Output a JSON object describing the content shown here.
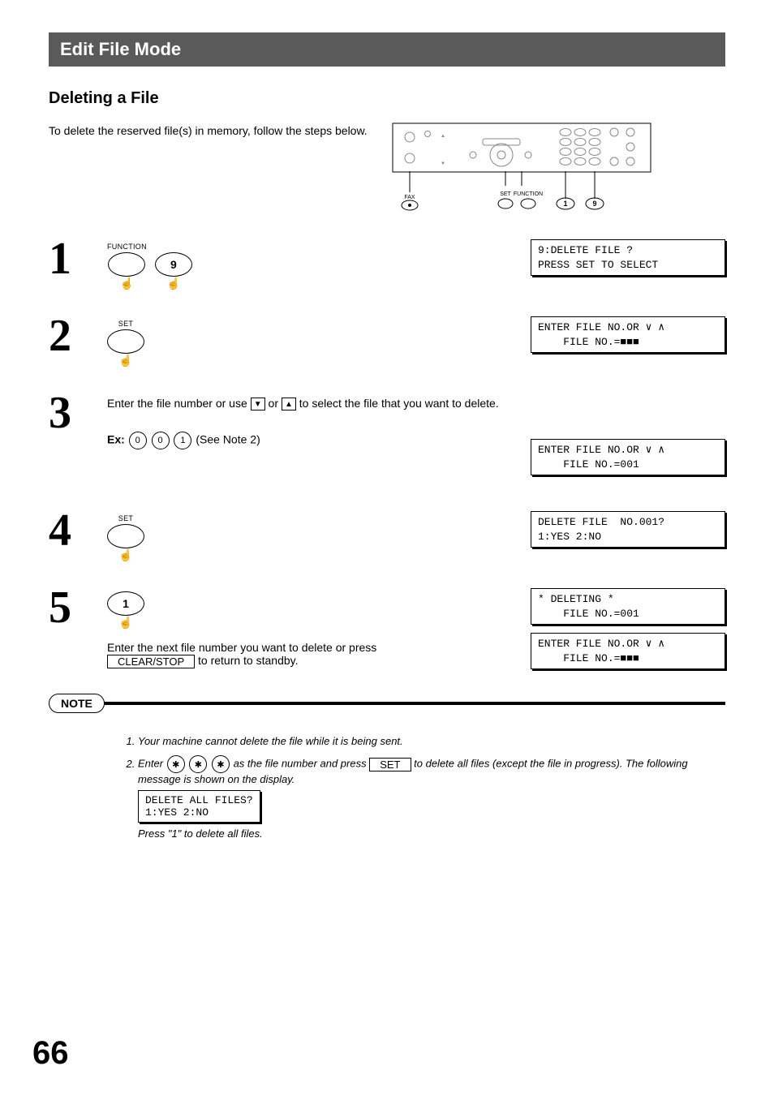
{
  "section_title": "Edit File Mode",
  "subheading": "Deleting a File",
  "intro": "To delete the reserved file(s) in memory, follow the steps below.",
  "panel_callouts": {
    "fax": "FAX",
    "set": "SET",
    "function": "FUNCTION",
    "k1": "1",
    "k9": "9"
  },
  "steps": {
    "s1": {
      "num": "1",
      "btn1_label": "FUNCTION",
      "btn2_text": "9",
      "lcd_line1": "9:DELETE FILE ?",
      "lcd_line2": "PRESS SET TO SELECT"
    },
    "s2": {
      "num": "2",
      "btn_label": "SET",
      "lcd_line1": "ENTER FILE NO.OR ∨ ∧",
      "lcd_line2": "    FILE NO.=■■■"
    },
    "s3": {
      "num": "3",
      "text_a": "Enter the file number or use ",
      "text_b": " or ",
      "text_c": " to select the file that you want to delete.",
      "ex_prefix": "Ex:",
      "ex_k1": "0",
      "ex_k2": "0",
      "ex_k3": "1",
      "ex_suffix": " (See Note 2)",
      "lcd_line1": "ENTER FILE NO.OR ∨ ∧",
      "lcd_line2": "    FILE NO.=001"
    },
    "s4": {
      "num": "4",
      "btn_label": "SET",
      "lcd_line1": "DELETE FILE  NO.001?",
      "lcd_line2": "1:YES 2:NO"
    },
    "s5": {
      "num": "5",
      "btn_text": "1",
      "text_a": "Enter the next file number you want to delete or press ",
      "clear_stop": "CLEAR/STOP",
      "text_b": " to return to standby.",
      "lcd1_line1": "* DELETING *",
      "lcd1_line2": "    FILE NO.=001",
      "lcd2_line1": "ENTER FILE NO.OR ∨ ∧",
      "lcd2_line2": "    FILE NO.=■■■"
    }
  },
  "note": {
    "label": "NOTE",
    "n1": "Your machine cannot delete the file while it is being sent.",
    "n2_a": "Enter ",
    "n2_key": "✱",
    "n2_b": " as the file number and press ",
    "n2_set": "SET",
    "n2_c": " to delete all files (except the file in progress). The following message is shown on the display.",
    "n2_lcd_line1": "DELETE ALL FILES?",
    "n2_lcd_line2": "1:YES 2:NO",
    "n2_d": "Press \"1\" to delete all files."
  },
  "page_number": "66"
}
